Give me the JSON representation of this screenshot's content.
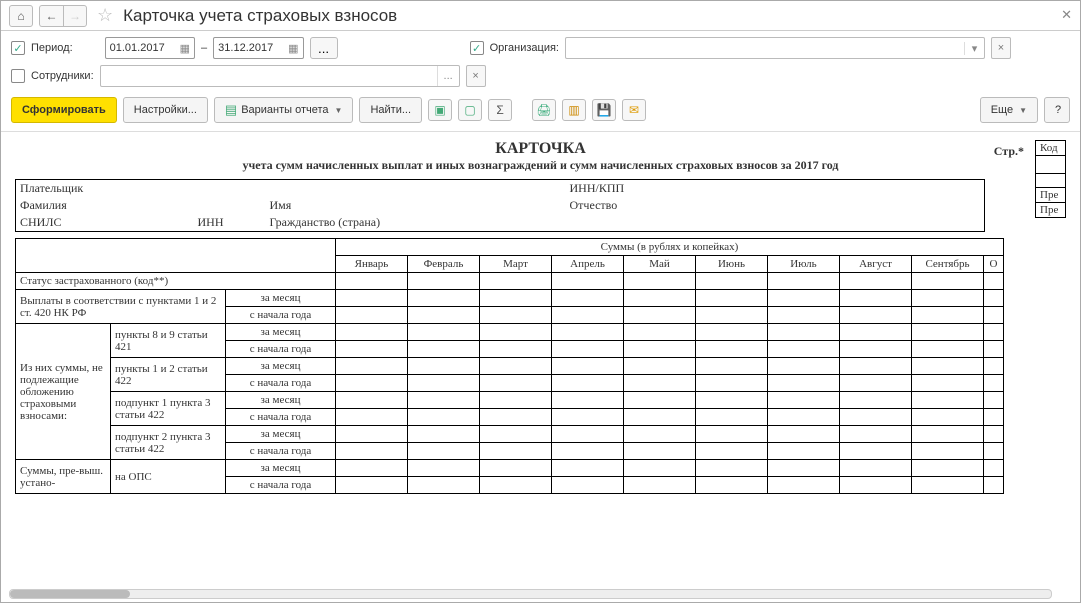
{
  "titlebar": {
    "title": "Карточка учета страховых взносов"
  },
  "filters": {
    "period_label": "Период:",
    "date_from": "01.01.2017",
    "date_sep": "–",
    "date_to": "31.12.2017",
    "org_label": "Организация:",
    "emp_label": "Сотрудники:"
  },
  "toolbar": {
    "generate": "Сформировать",
    "settings": "Настройки...",
    "variants": "Варианты отчета",
    "find": "Найти...",
    "more": "Еще",
    "help": "?"
  },
  "report": {
    "title": "КАРТОЧКА",
    "subtitle": "учета сумм начисленных выплат и иных вознаграждений и сумм начисленных страховых взносов за 2017 год",
    "page_label": "Стр.*",
    "codes": [
      "Код",
      "",
      "Пре",
      "Пре"
    ],
    "info": {
      "payer": "Плательщик",
      "lastname": "Фамилия",
      "name": "Имя",
      "patronymic": "Отчество",
      "snils": "СНИЛС",
      "inn_label": "ИНН",
      "citizenship": "Гражданство (страна)",
      "inn_kpp": "ИНН/КПП"
    },
    "sum_header": "Суммы (в рублях и копейках)",
    "months": [
      "Январь",
      "Февраль",
      "Март",
      "Апрель",
      "Май",
      "Июнь",
      "Июль",
      "Август",
      "Сентябрь",
      "О"
    ],
    "status_row": "Статус застрахованного (код**)",
    "period_month": "за месяц",
    "period_ytd": "с начала года",
    "rows": {
      "r1": "Выплаты в соответствии с пунктами 1 и 2 ст. 420 НК РФ",
      "group1": "Из них суммы, не подлежащие обложению страховыми взносами:",
      "g1a": "пункты 8 и 9 статьи 421",
      "g1b": "пункты 1 и 2 статьи 422",
      "g1c": "подпункт 1 пункта 3 статьи 422",
      "g1d": "подпункт 2 пункта 3 статьи 422",
      "group2": "Суммы, пре-выш. устано-",
      "g2a": "на ОПС"
    }
  }
}
